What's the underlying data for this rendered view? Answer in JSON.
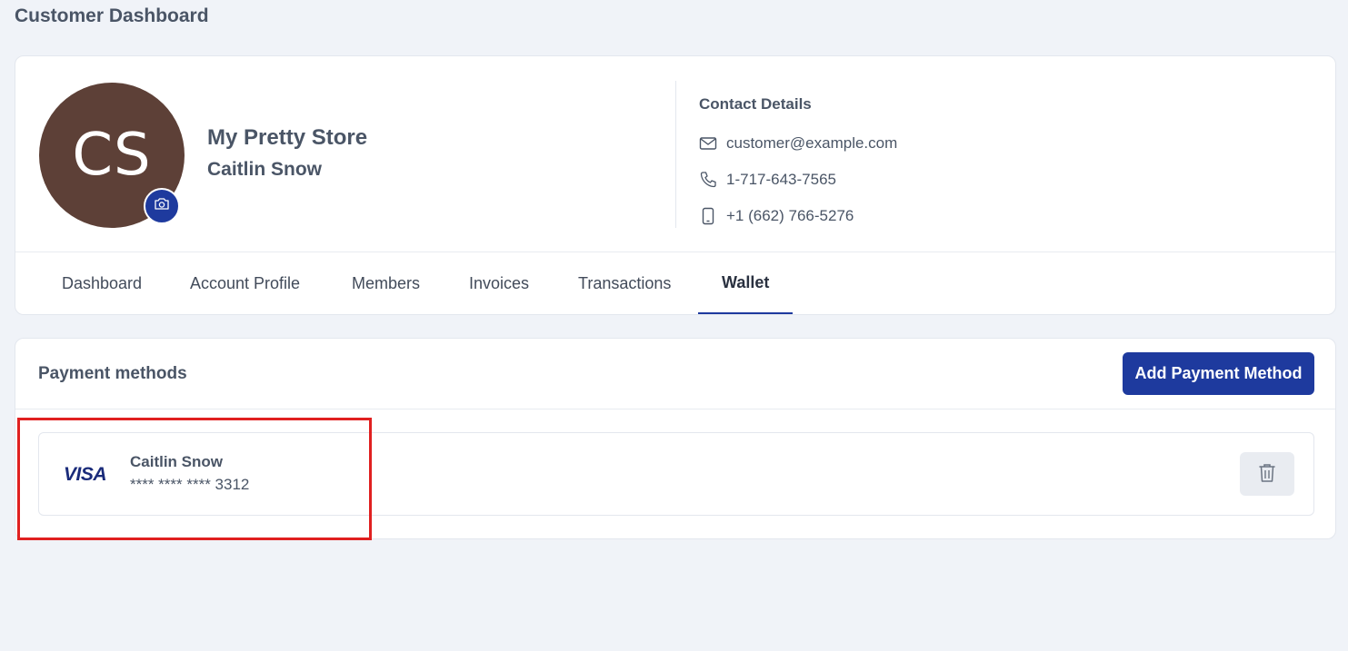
{
  "page": {
    "title": "Customer Dashboard"
  },
  "profile": {
    "initials": "CS",
    "avatar_color": "#5d4037",
    "store_name": "My Pretty Store",
    "customer_name": "Caitlin Snow",
    "camera_icon": "camera-icon"
  },
  "contact": {
    "title": "Contact Details",
    "email": "customer@example.com",
    "phone": "1-717-643-7565",
    "mobile": "+1 (662) 766-5276",
    "icons": [
      "mail-icon",
      "phone-icon",
      "mobile-icon"
    ]
  },
  "tabs": [
    {
      "label": "Dashboard",
      "active": false
    },
    {
      "label": "Account Profile",
      "active": false
    },
    {
      "label": "Members",
      "active": false
    },
    {
      "label": "Invoices",
      "active": false
    },
    {
      "label": "Transactions",
      "active": false
    },
    {
      "label": "Wallet",
      "active": true
    }
  ],
  "payment": {
    "title": "Payment methods",
    "add_label": "Add Payment Method",
    "methods": [
      {
        "brand": "VISA",
        "holder": "Caitlin Snow",
        "number": "**** **** **** 3312",
        "delete_icon": "trash-icon"
      }
    ]
  },
  "colors": {
    "accent": "#1e3a9e",
    "background": "#f0f3f8",
    "highlight": "#e02020"
  }
}
